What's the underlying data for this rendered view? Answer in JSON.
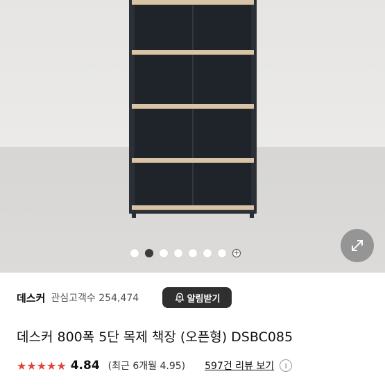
{
  "gallery": {
    "image_count": 7,
    "active_index": 1,
    "more_symbol": "+"
  },
  "seller": {
    "name": "데스커",
    "followers_label": "관심고객수 254,474",
    "follow_button": "알림받기"
  },
  "product": {
    "title": "데스커 800폭 5단 목제 책장 (오픈형) DSBC085"
  },
  "rating": {
    "stars": 5,
    "score": "4.84",
    "recent": "(최근 6개월 4.95)",
    "reviews_link": "597건 리뷰 보기",
    "info_symbol": "i"
  },
  "colors": {
    "star": "#e0443a",
    "button_bg": "#2f2f2f"
  }
}
